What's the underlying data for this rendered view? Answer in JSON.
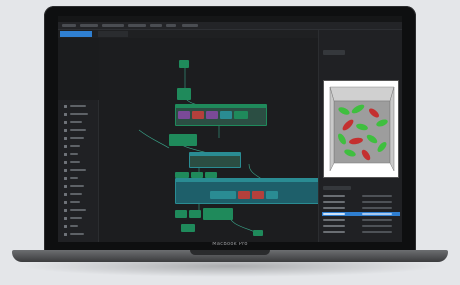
{
  "device": {
    "brand_label": "MacBook Pro"
  },
  "app": {
    "menu": [
      "File",
      "Edit",
      "View",
      "Window",
      "Graph",
      "Tools",
      "Help"
    ],
    "colors": {
      "accent": "#2f7fd1",
      "node_green": "#1f8a5b",
      "node_teal": "#2a8c93",
      "node_red": "#b3403c",
      "node_purple": "#7a4a98",
      "wire": "#3aa58a",
      "viewport_bg": "#ffffff",
      "viewport_green": "#3fbf3f",
      "viewport_red": "#c43030"
    }
  }
}
